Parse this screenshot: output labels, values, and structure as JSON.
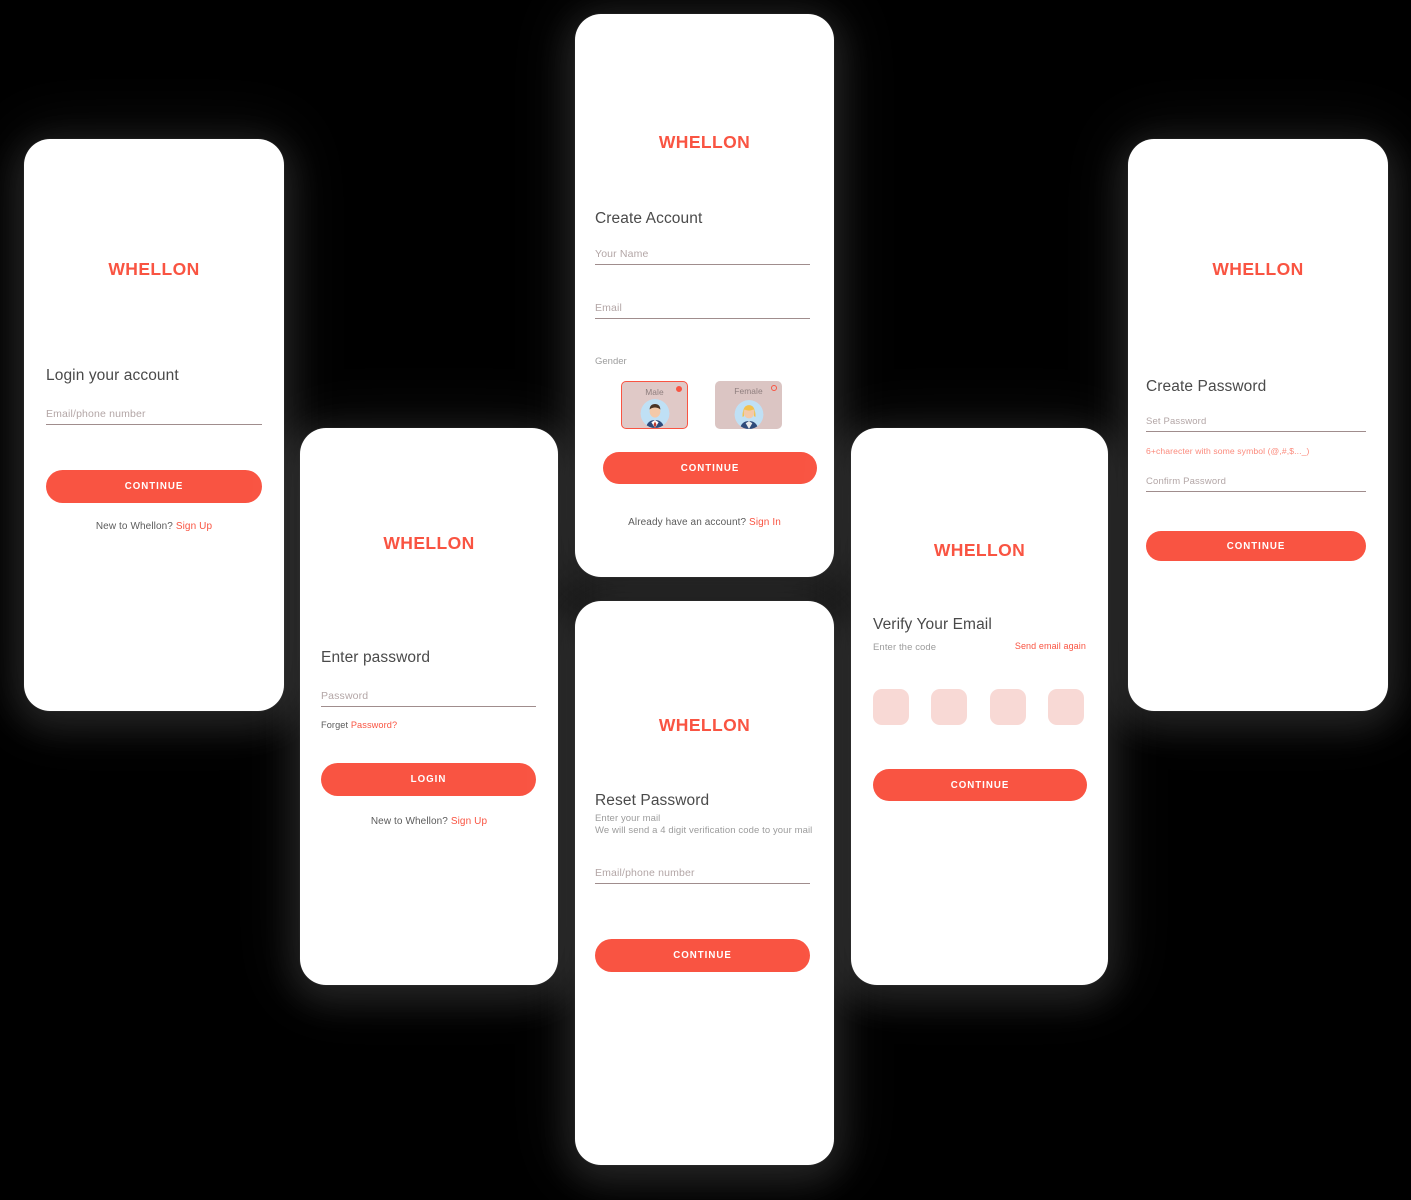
{
  "brand": "WHELLON",
  "colors": {
    "accent": "#F95442",
    "accent_soft": "#FB8A7C",
    "otp_box": "#F8D9D5",
    "field_underline": "#A08D8D",
    "placeholder": "#B3A6A6",
    "heading": "#4A4A4A",
    "background": "#000000",
    "card": "#FFFFFF"
  },
  "screens": [
    {
      "id": "login-account",
      "brand": "WHELLON",
      "heading": "Login your account",
      "field_placeholder": "Email/phone number",
      "button_label": "CONTINUE",
      "footer_text": "New to Whellon?",
      "footer_link": "Sign Up"
    },
    {
      "id": "enter-password",
      "brand": "WHELLON",
      "heading": "Enter password",
      "field_placeholder": "Password",
      "forget_text": "Forget",
      "forget_link": "Password?",
      "button_label": "LOGIN",
      "footer_text": "New to Whellon?",
      "footer_link": "Sign Up"
    },
    {
      "id": "create-account",
      "brand": "WHELLON",
      "heading": "Create Account",
      "name_placeholder": "Your Name",
      "email_placeholder": "Email",
      "gender_label": "Gender",
      "gender_options": [
        {
          "label": "Male",
          "selected": true,
          "avatar": "male-avatar-icon"
        },
        {
          "label": "Female",
          "selected": false,
          "avatar": "female-avatar-icon"
        }
      ],
      "button_label": "CONTINUE",
      "footer_text": "Already have an account?",
      "footer_link": "Sign In"
    },
    {
      "id": "reset-password",
      "brand": "WHELLON",
      "heading": "Reset Password",
      "sub_line_1": "Enter your mail",
      "sub_line_2": "We will send a 4 digit verification code to your mail",
      "field_placeholder": "Email/phone number",
      "button_label": "CONTINUE"
    },
    {
      "id": "verify-email",
      "brand": "WHELLON",
      "heading": "Verify Your Email",
      "sub_label": "Enter the  code",
      "resend_link": "Send email again",
      "otp_digits": [
        "",
        "",
        "",
        ""
      ],
      "button_label": "CONTINUE"
    },
    {
      "id": "create-password",
      "brand": "WHELLON",
      "heading": "Create Password",
      "set_placeholder": "Set Password",
      "hint": "6+charecter with some symbol (@,#,$..._)",
      "confirm_placeholder": "Confirm Password",
      "button_label": "CONTINUE"
    }
  ]
}
